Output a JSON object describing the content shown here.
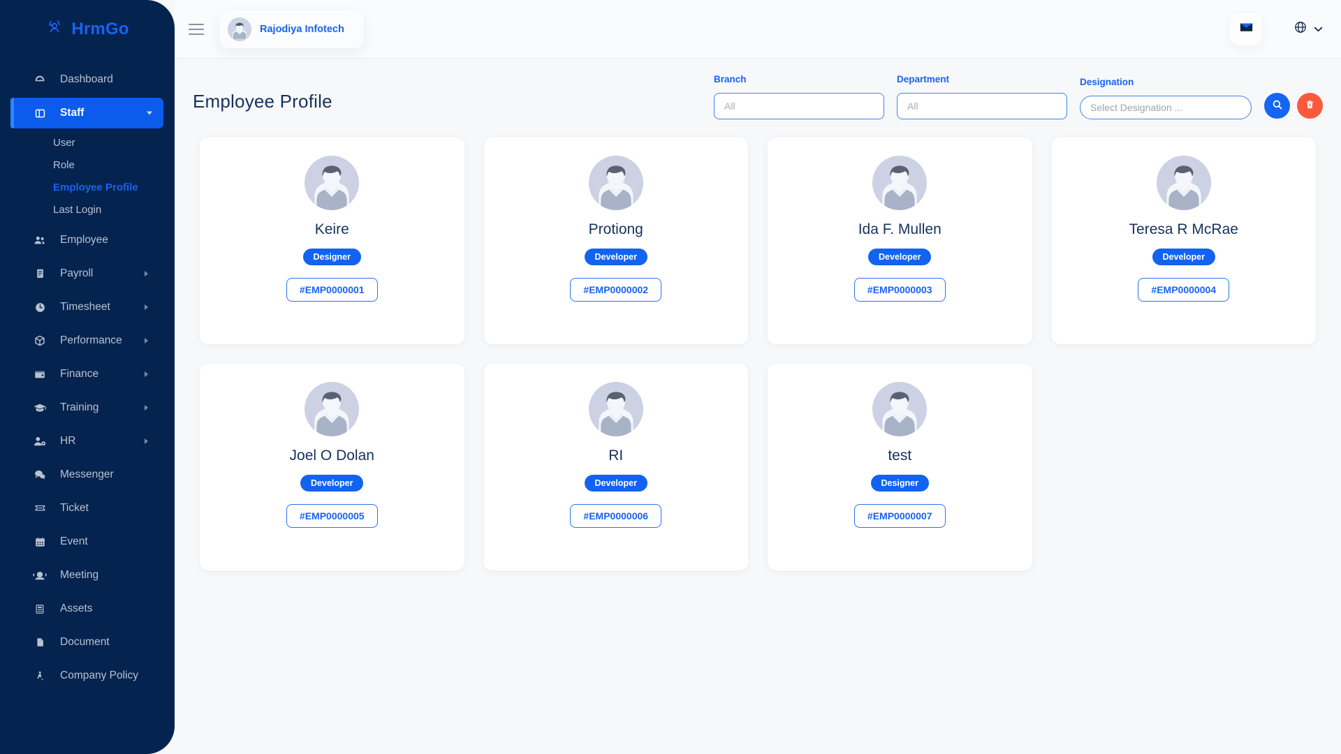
{
  "brand": {
    "name": "HrmGo",
    "icon": "hrmgo-logo-icon"
  },
  "sidebar": {
    "items": [
      {
        "label": "Dashboard",
        "icon": "dashboard-icon",
        "active": false,
        "expandable": false
      },
      {
        "label": "Staff",
        "icon": "staff-icon",
        "active": true,
        "expandable": true
      },
      {
        "label": "Employee",
        "icon": "employee-icon",
        "active": false,
        "expandable": false
      },
      {
        "label": "Payroll",
        "icon": "payroll-icon",
        "active": false,
        "expandable": true
      },
      {
        "label": "Timesheet",
        "icon": "clock-icon",
        "active": false,
        "expandable": true
      },
      {
        "label": "Performance",
        "icon": "box-icon",
        "active": false,
        "expandable": true
      },
      {
        "label": "Finance",
        "icon": "wallet-icon",
        "active": false,
        "expandable": true
      },
      {
        "label": "Training",
        "icon": "graduation-cap-icon",
        "active": false,
        "expandable": true
      },
      {
        "label": "HR",
        "icon": "user-gear-icon",
        "active": false,
        "expandable": true
      },
      {
        "label": "Messenger",
        "icon": "chat-icon",
        "active": false,
        "expandable": false
      },
      {
        "label": "Ticket",
        "icon": "ticket-icon",
        "active": false,
        "expandable": false
      },
      {
        "label": "Event",
        "icon": "calendar-icon",
        "active": false,
        "expandable": false
      },
      {
        "label": "Meeting",
        "icon": "meeting-icon",
        "active": false,
        "expandable": false
      },
      {
        "label": "Assets",
        "icon": "assets-icon",
        "active": false,
        "expandable": false
      },
      {
        "label": "Document",
        "icon": "document-icon",
        "active": false,
        "expandable": false
      },
      {
        "label": "Company Policy",
        "icon": "policy-icon",
        "active": false,
        "expandable": false
      }
    ],
    "staff_submenu": [
      {
        "label": "User",
        "active": false
      },
      {
        "label": "Role",
        "active": false
      },
      {
        "label": "Employee Profile",
        "active": true
      },
      {
        "label": "Last Login",
        "active": false
      }
    ]
  },
  "topbar": {
    "menu_toggle_icon": "hamburger-icon",
    "company_name": "Rajodiya Infotech",
    "company_avatar_icon": "user-avatar-icon",
    "mail_icon": "envelope-icon",
    "language_icon": "globe-icon",
    "language_caret_icon": "chevron-down-icon"
  },
  "page": {
    "title": "Employee Profile"
  },
  "filters": {
    "branch": {
      "label": "Branch",
      "value": "",
      "placeholder": "All"
    },
    "department": {
      "label": "Department",
      "value": "",
      "placeholder": "All"
    },
    "designation": {
      "label": "Designation",
      "value": "",
      "placeholder": "Select Designation ..."
    },
    "search_button": {
      "icon": "search-icon",
      "title": "Search"
    },
    "reset_button": {
      "icon": "trash-icon",
      "title": "Reset"
    }
  },
  "employees": [
    {
      "name": "Keire",
      "role": "Designer",
      "id": "#EMP0000001",
      "avatar": "user-avatar-icon"
    },
    {
      "name": "Protiong",
      "role": "Developer",
      "id": "#EMP0000002",
      "avatar": "user-avatar-icon"
    },
    {
      "name": "Ida F. Mullen",
      "role": "Developer",
      "id": "#EMP0000003",
      "avatar": "user-avatar-icon"
    },
    {
      "name": "Teresa R McRae",
      "role": "Developer",
      "id": "#EMP0000004",
      "avatar": "user-avatar-icon"
    },
    {
      "name": "Joel O Dolan",
      "role": "Developer",
      "id": "#EMP0000005",
      "avatar": "user-avatar-icon"
    },
    {
      "name": "RI",
      "role": "Developer",
      "id": "#EMP0000006",
      "avatar": "user-avatar-icon"
    },
    {
      "name": "test",
      "role": "Designer",
      "id": "#EMP0000007",
      "avatar": "user-avatar-icon"
    }
  ],
  "colors": {
    "sidebar_bg": "#04234f",
    "accent_blue": "#1a62f0",
    "active_nav": "#0b5ced",
    "search_button": "#1565f2",
    "reset_button": "#fa5a3c",
    "page_bg": "#f7f8fa",
    "title_text": "#16325c"
  }
}
